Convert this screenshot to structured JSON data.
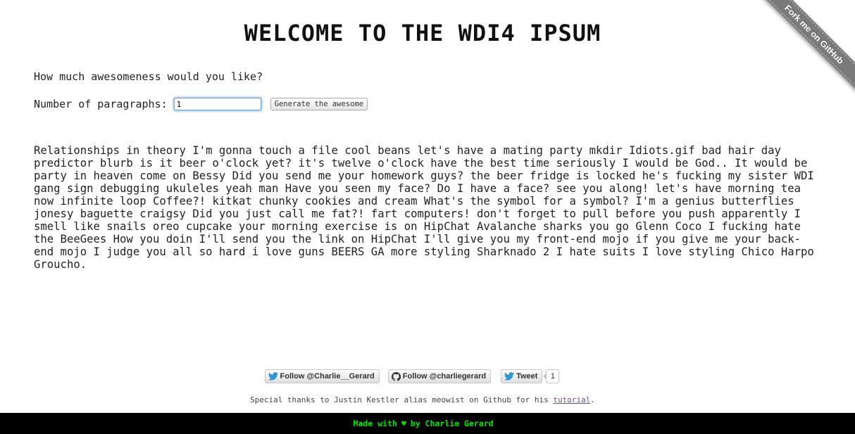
{
  "page": {
    "title": "WELCOME TO THE WDI4 IPSUM"
  },
  "form": {
    "prompt": "How much awesomeness would you like?",
    "paragraphs_label": "Number of paragraphs:",
    "paragraphs_value": "1",
    "generate_label": "Generate the awesome"
  },
  "output": {
    "paragraph": "Relationships in theory I'm gonna touch a file cool beans let's have a mating party mkdir Idiots.gif bad hair day predictor blurb is it beer o'clock yet? it's twelve o'clock have the best time seriously I would be God.. It would be party in heaven come on Bessy Did you send me your homework guys? the beer fridge is locked he's fucking my sister WDI gang sign debugging ukuleles yeah man Have you seen my face? Do I have a face? see you along! let's have morning tea now infinite loop Coffee?! kitkat chunky cookies and cream What's the symbol for a symbol? I'm a genius butterflies jonesy baguette craigsy Did you just call me fat?! fart computers! don't forget to pull before you push apparently I smell like snails oreo cupcake your morning exercise is on HipChat Avalanche sharks you go Glenn Coco I fucking hate the BeeGees How you doin I'll send you the link on HipChat I'll give you my front-end mojo if you give me your back-end mojo I judge you all so hard i love guns BEERS GA more styling Sharknado 2 I hate suits I love styling Chico Harpo Groucho."
  },
  "ribbon": {
    "label": "Fork me on GitHub",
    "color": "#7a7a7a"
  },
  "social": {
    "twitter_follow": "Follow @Charlie__Gerard",
    "github_follow": "Follow @charliegerard",
    "tweet": "Tweet",
    "tweet_count": "1",
    "twitter_icon": "twitter-bird-icon",
    "github_icon": "github-octocat-icon"
  },
  "credits": {
    "thanks_text": "Special thanks to Justin Kestler alias meowist on Github for his",
    "tutorial_link": "tutorial",
    "period": "."
  },
  "footer": {
    "made_with": "Made with",
    "heart": "♥",
    "by": "by Charlie Gerard",
    "text_color": "#00e000",
    "background": "#000000"
  }
}
